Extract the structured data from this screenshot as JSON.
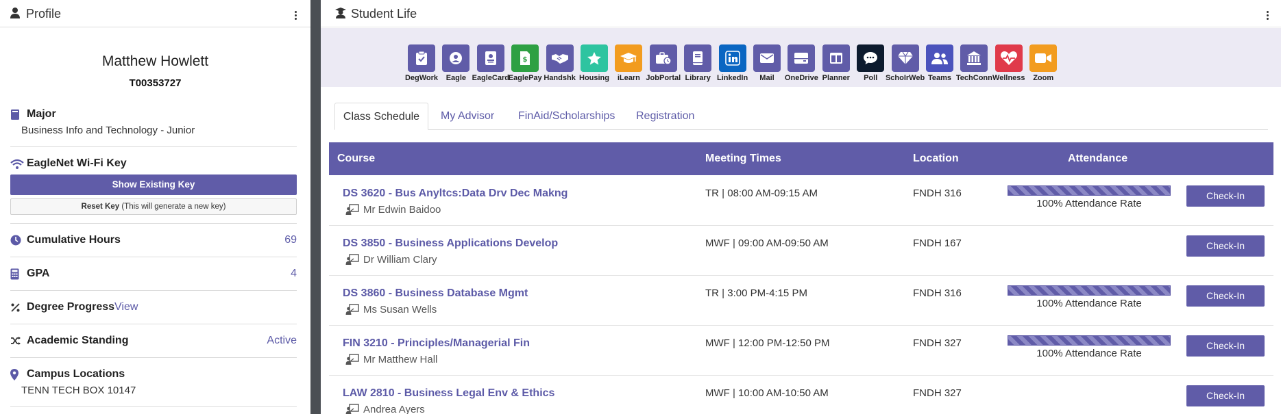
{
  "profile": {
    "header_title": "Profile",
    "name": "Matthew Howlett",
    "student_id": "T00353727",
    "major_label": "Major",
    "major_value": "Business Info and Technology - Junior",
    "wifi_label": "EagleNet Wi-Fi Key",
    "show_key_button": "Show Existing Key",
    "reset_key_bold": "Reset Key",
    "reset_key_note": " (This will generate a new key)",
    "hours_label": "Cumulative Hours",
    "hours_value": "69",
    "gpa_label": "GPA",
    "gpa_value": "4",
    "progress_label": "Degree Progress",
    "progress_link": "View",
    "standing_label": "Academic Standing",
    "standing_value": "Active",
    "campus_label": "Campus Locations",
    "campus_value": "TENN TECH BOX 10147"
  },
  "student_life": {
    "header_title": "Student Life",
    "tiles": [
      {
        "label": "DegWork",
        "icon": "clipboard-check-icon",
        "color": "#605ca8"
      },
      {
        "label": "Eagle",
        "icon": "user-circle-icon",
        "color": "#605ca8"
      },
      {
        "label": "EagleCard",
        "icon": "id-card-icon",
        "color": "#605ca8"
      },
      {
        "label": "EaglePay",
        "icon": "dollar-file-icon",
        "color": "#2ea043"
      },
      {
        "label": "Handshk",
        "icon": "handshake-icon",
        "color": "#605ca8"
      },
      {
        "label": "Housing",
        "icon": "star-icon",
        "color": "#2ec4a0"
      },
      {
        "label": "iLearn",
        "icon": "graduation-cap-icon",
        "color": "#f29c1f"
      },
      {
        "label": "JobPortal",
        "icon": "briefcase-clock-icon",
        "color": "#605ca8"
      },
      {
        "label": "Library",
        "icon": "book-icon",
        "color": "#605ca8"
      },
      {
        "label": "LinkedIn",
        "icon": "linkedin-icon",
        "color": "#0a66c2"
      },
      {
        "label": "Mail",
        "icon": "envelope-icon",
        "color": "#605ca8"
      },
      {
        "label": "OneDrive",
        "icon": "hard-drive-icon",
        "color": "#605ca8"
      },
      {
        "label": "Planner",
        "icon": "columns-icon",
        "color": "#605ca8"
      },
      {
        "label": "Poll",
        "icon": "chat-bubble-icon",
        "color": "#0d1b2e"
      },
      {
        "label": "SchoIrWeb",
        "icon": "gem-icon",
        "color": "#605ca8"
      },
      {
        "label": "Teams",
        "icon": "users-icon",
        "color": "#4b53bc"
      },
      {
        "label": "TechConn",
        "icon": "bank-icon",
        "color": "#605ca8"
      },
      {
        "label": "Wellness",
        "icon": "heart-pulse-icon",
        "color": "#e03a4a"
      },
      {
        "label": "Zoom",
        "icon": "video-camera-icon",
        "color": "#f29c1f"
      }
    ],
    "tabs": [
      "Class Schedule",
      "My Advisor",
      "FinAid/Scholarships",
      "Registration"
    ],
    "active_tab": "Class Schedule",
    "table": {
      "headers": [
        "Course",
        "Meeting Times",
        "Location",
        "Attendance"
      ],
      "checkin_label": "Check-In",
      "rows": [
        {
          "course": "DS 3620 - Bus Anyltcs:Data Drv Dec Makng",
          "instructor": "Mr Edwin Baidoo",
          "meeting": "TR | 08:00 AM-09:15 AM",
          "location": "FNDH 316",
          "attendance": "100% Attendance Rate",
          "attendance_pct": 100
        },
        {
          "course": "DS 3850 - Business Applications Develop",
          "instructor": "Dr William Clary",
          "meeting": "MWF | 09:00 AM-09:50 AM",
          "location": "FNDH 167",
          "attendance": "",
          "attendance_pct": null
        },
        {
          "course": "DS 3860 - Business Database Mgmt",
          "instructor": "Ms Susan Wells",
          "meeting": "TR | 3:00 PM-4:15 PM",
          "location": "FNDH 316",
          "attendance": "100% Attendance Rate",
          "attendance_pct": 100
        },
        {
          "course": "FIN 3210 - Principles/Managerial Fin",
          "instructor": "Mr Matthew Hall",
          "meeting": "MWF | 12:00 PM-12:50 PM",
          "location": "FNDH 327",
          "attendance": "100% Attendance Rate",
          "attendance_pct": 100
        },
        {
          "course": "LAW 2810 - Business Legal Env & Ethics",
          "instructor": "Andrea Ayers",
          "meeting": "MWF | 10:00 AM-10:50 AM",
          "location": "FNDH 327",
          "attendance": "",
          "attendance_pct": null
        }
      ]
    }
  },
  "colors": {
    "accent": "#605ca8",
    "link": "#5c5aa7",
    "panel_bg": "#4b4f54"
  }
}
